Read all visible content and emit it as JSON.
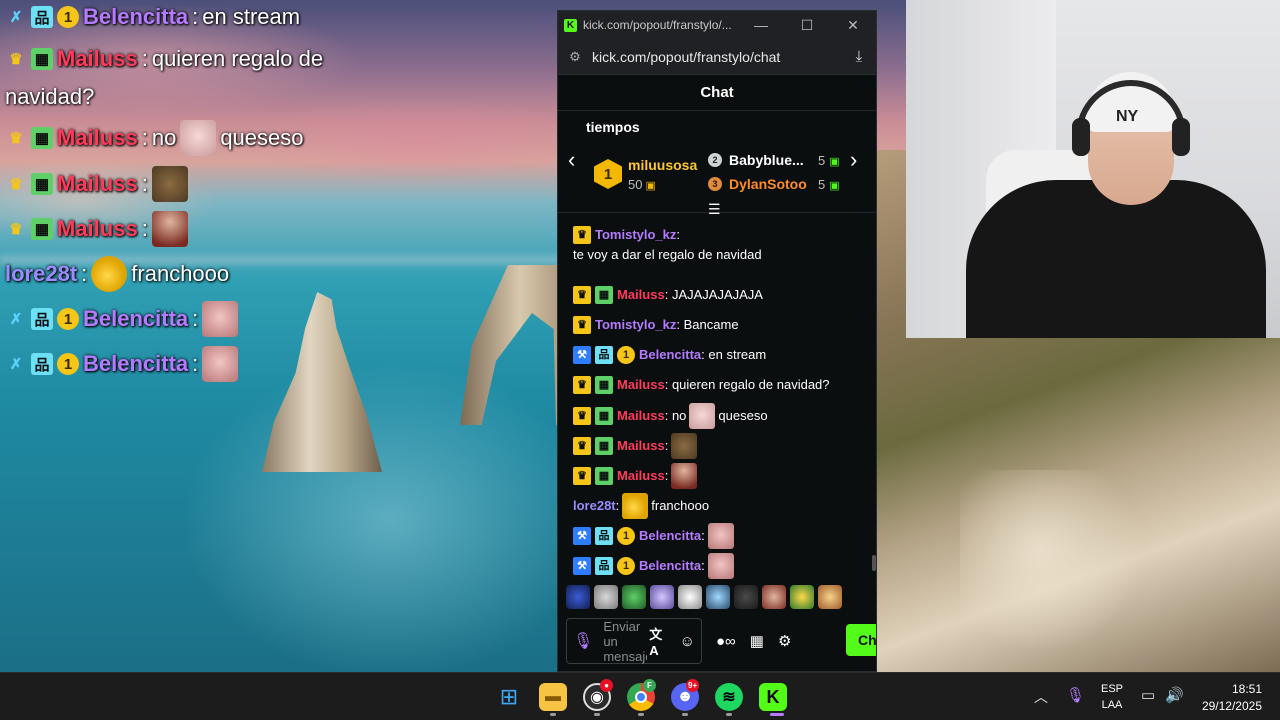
{
  "overlay_chat": [
    {
      "user": "Belencitta",
      "message": "en stream",
      "badges": [
        "sword",
        "grid",
        "one"
      ],
      "color": "purple"
    },
    {
      "user": "Mailuss",
      "message": "quieren regalo de",
      "message_cont": "navidad?",
      "badges": [
        "crown",
        "creeper"
      ],
      "color": "red"
    },
    {
      "user": "Mailuss",
      "message": "no",
      "message_after": "queseso",
      "emote": "pig-emote",
      "badges": [
        "crown",
        "creeper"
      ],
      "color": "red"
    },
    {
      "user": "Mailuss",
      "message": "",
      "emote": "frog-emote",
      "badges": [
        "crown",
        "creeper"
      ],
      "color": "red"
    },
    {
      "user": "Mailuss",
      "message": "",
      "emote": "bald-emote",
      "badges": [
        "crown",
        "creeper"
      ],
      "color": "red"
    },
    {
      "user": "lore28t",
      "message": "franchooo",
      "emote": "santa-emote",
      "badges": [],
      "color": "violet"
    },
    {
      "user": "Belencitta",
      "message": "",
      "emote": "baby-emote",
      "badges": [
        "sword",
        "grid",
        "one"
      ],
      "color": "purple"
    },
    {
      "user": "Belencitta",
      "message": "",
      "emote": "baby-emote",
      "badges": [
        "sword",
        "grid",
        "one"
      ],
      "color": "purple"
    }
  ],
  "overlay_badge_glyphs": {
    "sword": "✗",
    "grid": "品",
    "one": "1",
    "crown": "♛",
    "creeper": "▦"
  },
  "window": {
    "title": "kick.com/popout/franstylo/...",
    "url": "kick.com/popout/franstylo/chat",
    "minimize_icon": "—",
    "maximize_icon": "☐",
    "close_icon": "✕"
  },
  "chat": {
    "header": "Chat",
    "leaderboard": {
      "title": "tiempos",
      "first": {
        "rank": "1",
        "name": "miluusosa",
        "count": "50"
      },
      "second": {
        "rank": "2",
        "name": "Babyblue...",
        "count": "5"
      },
      "third": {
        "rank": "3",
        "name": "DylanSotoo",
        "count": "5"
      }
    },
    "messages": [
      {
        "user": "Tomistylo_kz",
        "sep": ":",
        "text": "te voy a dar el regalo de navidad",
        "badges": [
          "crown"
        ],
        "color": "purple"
      },
      {
        "user": "Mailuss",
        "sep": ":",
        "text": "JAJAJAJAJAJA",
        "badges": [
          "crown",
          "creeper"
        ],
        "color": "red"
      },
      {
        "user": "Tomistylo_kz",
        "sep": ":",
        "text": "Bancame",
        "badges": [
          "crown"
        ],
        "color": "purple"
      },
      {
        "user": "Belencitta",
        "sep": ":",
        "text": "en stream",
        "badges": [
          "hammer",
          "grid",
          "one"
        ],
        "color": "purple"
      },
      {
        "user": "Mailuss",
        "sep": ":",
        "text": "quieren regalo de navidad?",
        "badges": [
          "crown",
          "creeper"
        ],
        "color": "red"
      },
      {
        "user": "Mailuss",
        "sep": ":",
        "text": "no",
        "text_after": "queseso",
        "emote": "pig",
        "badges": [
          "crown",
          "creeper"
        ],
        "color": "red"
      },
      {
        "user": "Mailuss",
        "sep": ":",
        "text": "",
        "emote": "frog",
        "badges": [
          "crown",
          "creeper"
        ],
        "color": "red"
      },
      {
        "user": "Mailuss",
        "sep": ":",
        "text": "",
        "emote": "bald",
        "badges": [
          "crown",
          "creeper"
        ],
        "color": "red"
      },
      {
        "user": "lore28t",
        "sep": ":",
        "text": "franchooo",
        "emote": "santa",
        "badges": [],
        "color": "violet"
      },
      {
        "user": "Belencitta",
        "sep": ":",
        "text": "",
        "emote": "baby",
        "badges": [
          "hammer",
          "grid",
          "one"
        ],
        "color": "purple"
      },
      {
        "user": "Belencitta",
        "sep": ":",
        "text": "",
        "emote": "baby",
        "badges": [
          "hammer",
          "grid",
          "one"
        ],
        "color": "purple"
      }
    ],
    "badge_glyphs": {
      "crown": "♛",
      "creeper": "▦",
      "hammer": "⚒",
      "grid": "品",
      "one": "1"
    },
    "input_placeholder": "Enviar un mensaje",
    "send_label": "Ch"
  },
  "taskbar": {
    "chrome_badge": "F",
    "discord_badge": "9+",
    "language": "ESP",
    "layout": "LAA",
    "time": "18:51",
    "date": "29/12/2025"
  },
  "colors": {
    "kick_green": "#53fc18",
    "user_purple": "#b57bff",
    "user_red": "#ff3b5c",
    "gold": "#f5c518"
  }
}
